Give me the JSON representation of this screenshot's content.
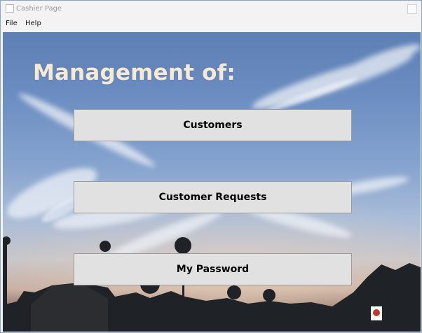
{
  "window": {
    "title": "Cashier Page"
  },
  "menu": {
    "file": "File",
    "help": "Help"
  },
  "main": {
    "heading": "Management of:",
    "buttons": {
      "customers": "Customers",
      "customer_requests": "Customer Requests",
      "my_password": "My Password"
    }
  },
  "colors": {
    "heading": "#f6ead6",
    "button_bg": "#e1e1e1",
    "button_border": "#9c9c9c",
    "window_border": "#8aa6c9"
  },
  "icons": [
    "app-icon",
    "window-control"
  ]
}
